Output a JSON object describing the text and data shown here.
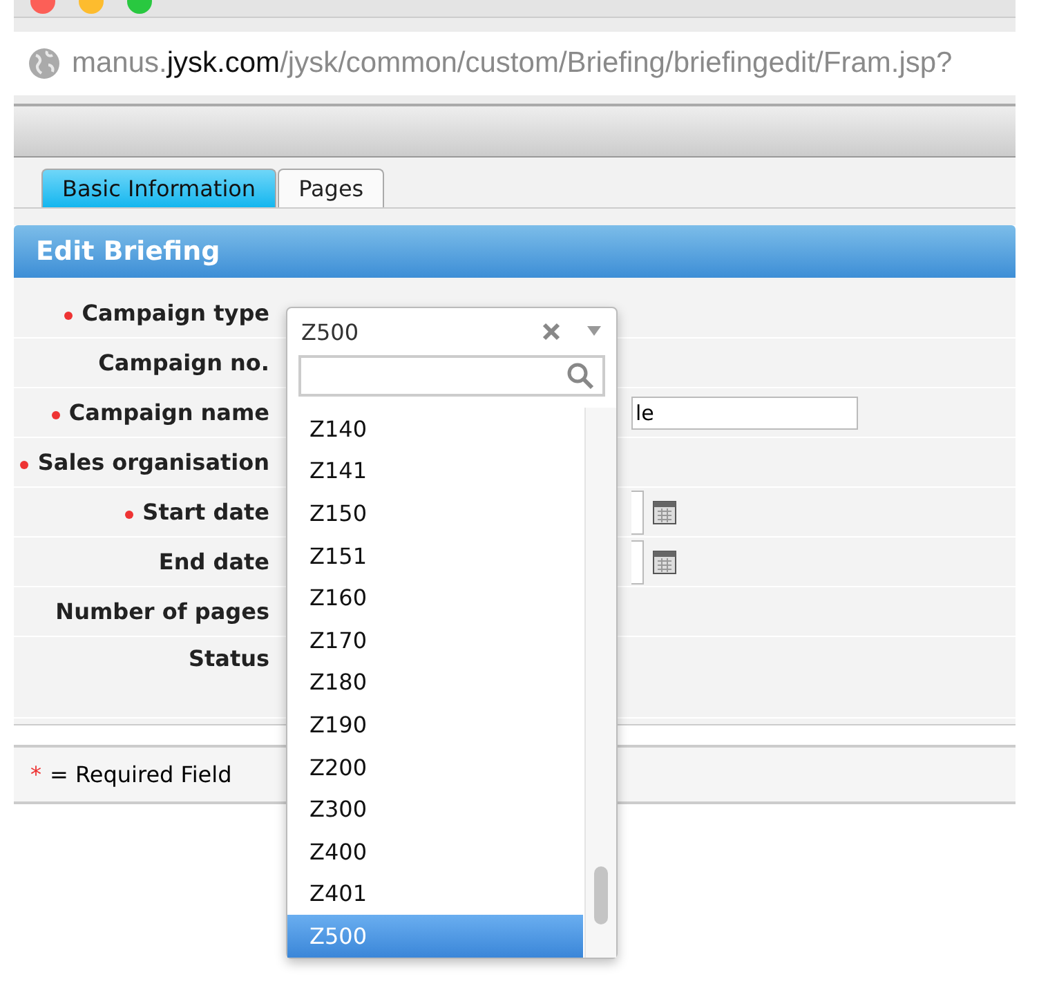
{
  "browser": {
    "url": {
      "subdomain": "manus.",
      "domain": "jysk.com",
      "path": "/jysk/common/custom/Briefing/briefingedit/Fram.jsp?"
    }
  },
  "tabs": [
    {
      "label": "Basic Information",
      "selected": true
    },
    {
      "label": "Pages",
      "selected": false
    }
  ],
  "panel": {
    "title": "Edit Briefing"
  },
  "form": [
    {
      "label": "Campaign type",
      "required": true,
      "kind": "select"
    },
    {
      "label": "Campaign no.",
      "required": false,
      "kind": "hidden"
    },
    {
      "label": "Campaign name",
      "required": true,
      "kind": "text",
      "value": "le"
    },
    {
      "label": "Sales organisation",
      "required": true,
      "kind": "hidden"
    },
    {
      "label": "Start date",
      "required": true,
      "kind": "date"
    },
    {
      "label": "End date",
      "required": false,
      "kind": "date"
    },
    {
      "label": "Number of pages",
      "required": false,
      "kind": "hidden"
    },
    {
      "label": "Status",
      "required": false,
      "kind": "status"
    }
  ],
  "footer": {
    "mark": "*",
    "text": "= Required Field"
  },
  "dropdown": {
    "value": "Z500",
    "options": [
      {
        "label": "Z140",
        "selected": false
      },
      {
        "label": "Z141",
        "selected": false
      },
      {
        "label": "Z150",
        "selected": false
      },
      {
        "label": "Z151",
        "selected": false
      },
      {
        "label": "Z160",
        "selected": false
      },
      {
        "label": "Z170",
        "selected": false
      },
      {
        "label": "Z180",
        "selected": false
      },
      {
        "label": "Z190",
        "selected": false
      },
      {
        "label": "Z200",
        "selected": false
      },
      {
        "label": "Z300",
        "selected": false
      },
      {
        "label": "Z400",
        "selected": false
      },
      {
        "label": "Z401",
        "selected": false
      },
      {
        "label": "Z500",
        "selected": true
      }
    ]
  }
}
